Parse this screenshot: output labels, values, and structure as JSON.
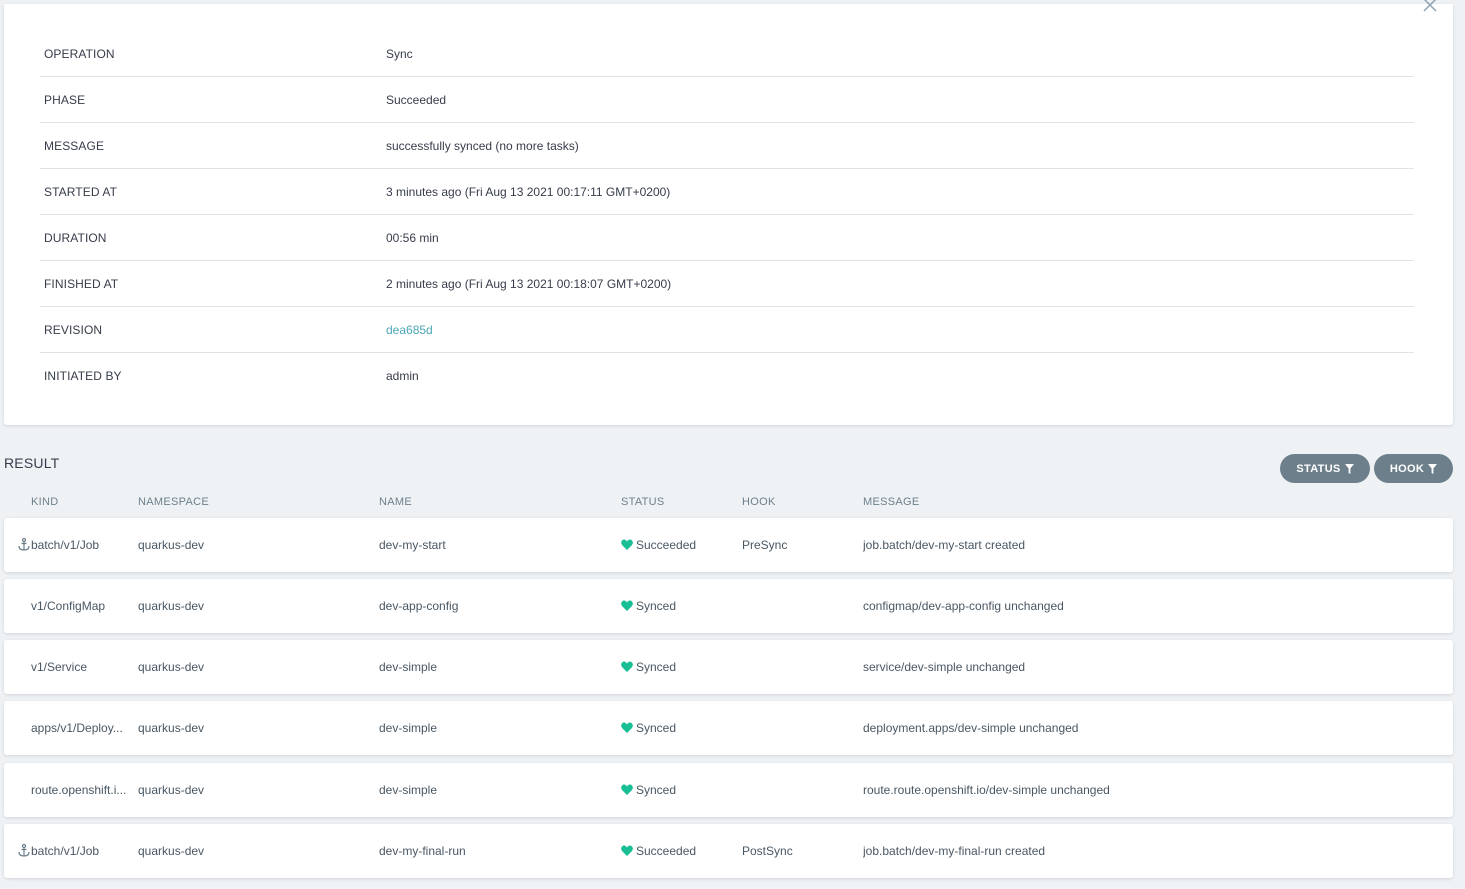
{
  "details": {
    "rows": [
      {
        "label": "OPERATION",
        "value": "Sync"
      },
      {
        "label": "PHASE",
        "value": "Succeeded"
      },
      {
        "label": "MESSAGE",
        "value": "successfully synced (no more tasks)"
      },
      {
        "label": "STARTED AT",
        "value": "3 minutes ago (Fri Aug 13 2021 00:17:11 GMT+0200)"
      },
      {
        "label": "DURATION",
        "value": "00:56 min"
      },
      {
        "label": "FINISHED AT",
        "value": "2 minutes ago (Fri Aug 13 2021 00:18:07 GMT+0200)"
      },
      {
        "label": "REVISION",
        "value": "dea685d"
      },
      {
        "label": "INITIATED BY",
        "value": "admin"
      }
    ]
  },
  "result": {
    "title": "RESULT",
    "filters": {
      "status_label": "STATUS",
      "hook_label": "HOOK"
    },
    "columns": {
      "kind": "KIND",
      "namespace": "NAMESPACE",
      "name": "NAME",
      "status": "STATUS",
      "hook": "HOOK",
      "message": "MESSAGE"
    },
    "rows": [
      {
        "kind": "batch/v1/Job",
        "namespace": "quarkus-dev",
        "name": "dev-my-start",
        "status": "Succeeded",
        "hook": "PreSync",
        "message": "job.batch/dev-my-start created",
        "is_hook": true
      },
      {
        "kind": "v1/ConfigMap",
        "namespace": "quarkus-dev",
        "name": "dev-app-config",
        "status": "Synced",
        "hook": "",
        "message": "configmap/dev-app-config unchanged",
        "is_hook": false
      },
      {
        "kind": "v1/Service",
        "namespace": "quarkus-dev",
        "name": "dev-simple",
        "status": "Synced",
        "hook": "",
        "message": "service/dev-simple unchanged",
        "is_hook": false
      },
      {
        "kind": "apps/v1/Deploy...",
        "namespace": "quarkus-dev",
        "name": "dev-simple",
        "status": "Synced",
        "hook": "",
        "message": "deployment.apps/dev-simple unchanged",
        "is_hook": false
      },
      {
        "kind": "route.openshift.i...",
        "namespace": "quarkus-dev",
        "name": "dev-simple",
        "status": "Synced",
        "hook": "",
        "message": "route.route.openshift.io/dev-simple unchanged",
        "is_hook": false
      },
      {
        "kind": "batch/v1/Job",
        "namespace": "quarkus-dev",
        "name": "dev-my-final-run",
        "status": "Succeeded",
        "hook": "PostSync",
        "message": "job.batch/dev-my-final-run created",
        "is_hook": true
      }
    ]
  },
  "colors": {
    "accent_link": "#4ba7b8",
    "healthy": "#18be94",
    "filter_button": "#6d7f8b"
  }
}
